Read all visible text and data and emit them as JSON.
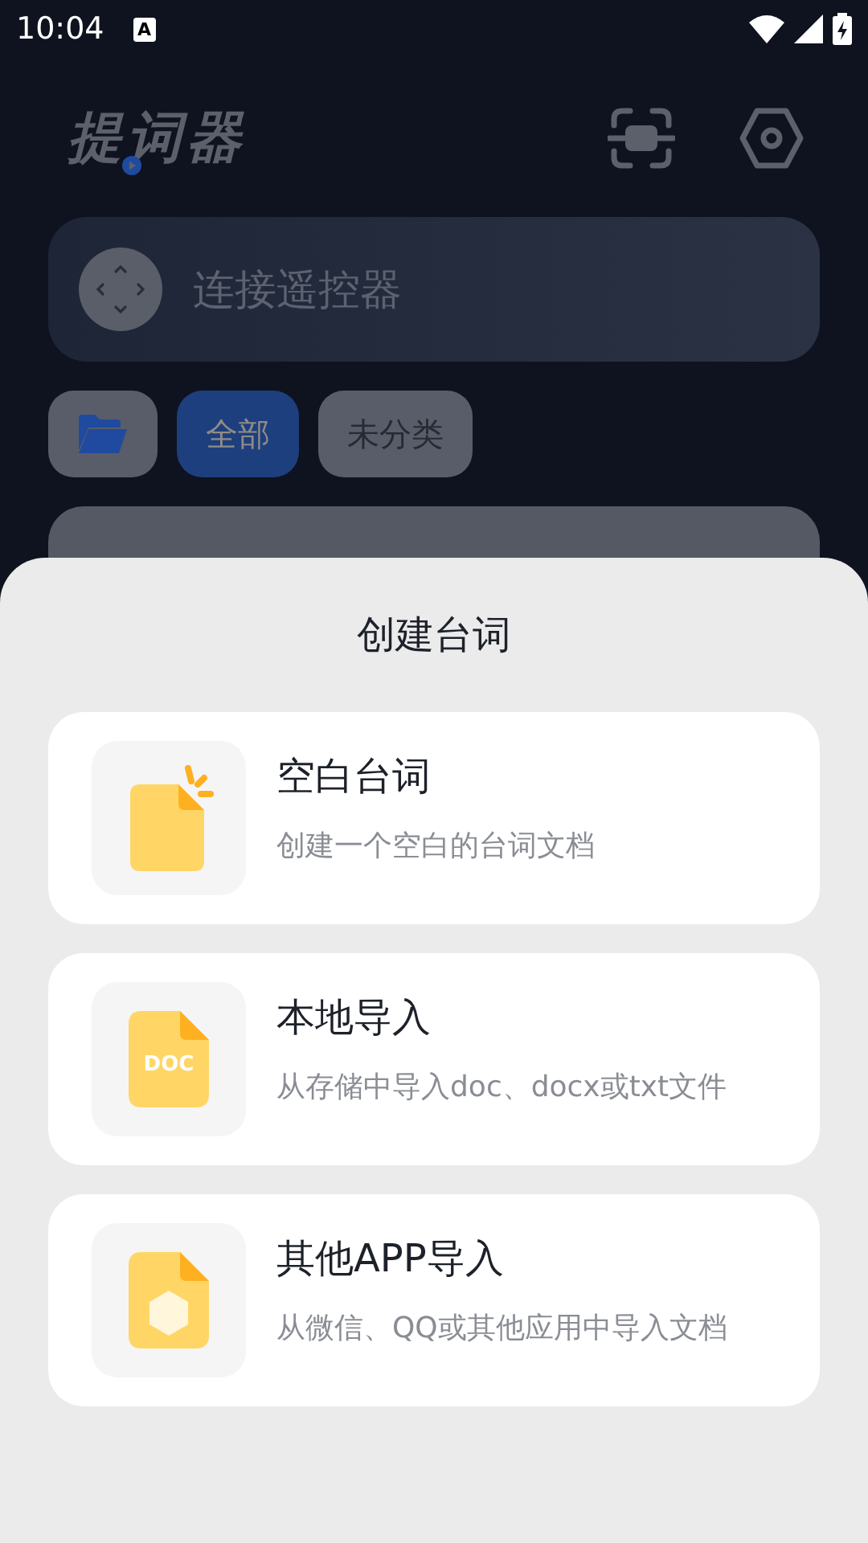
{
  "status_bar": {
    "time": "10:04",
    "notification_glyph": "A"
  },
  "header": {
    "logo": "提词器"
  },
  "remote": {
    "label": "连接遥控器"
  },
  "chips": [
    {
      "kind": "folder",
      "selected": false
    },
    {
      "kind": "text",
      "label": "全部",
      "selected": true
    },
    {
      "kind": "text",
      "label": "未分类",
      "selected": false
    }
  ],
  "script_card": {
    "kind": "card"
  },
  "sheet": {
    "title": "创建台词",
    "options": [
      {
        "kind": "blank",
        "title": "空白台词",
        "description": "创建一个空白的台词文档"
      },
      {
        "kind": "doc",
        "badge": "DOC",
        "title": "本地导入",
        "description": "从存储中导入doc、docx或txt文件"
      },
      {
        "kind": "app",
        "title": "其他APP导入",
        "description": "从微信、QQ或其他应用中导入文档"
      }
    ]
  }
}
